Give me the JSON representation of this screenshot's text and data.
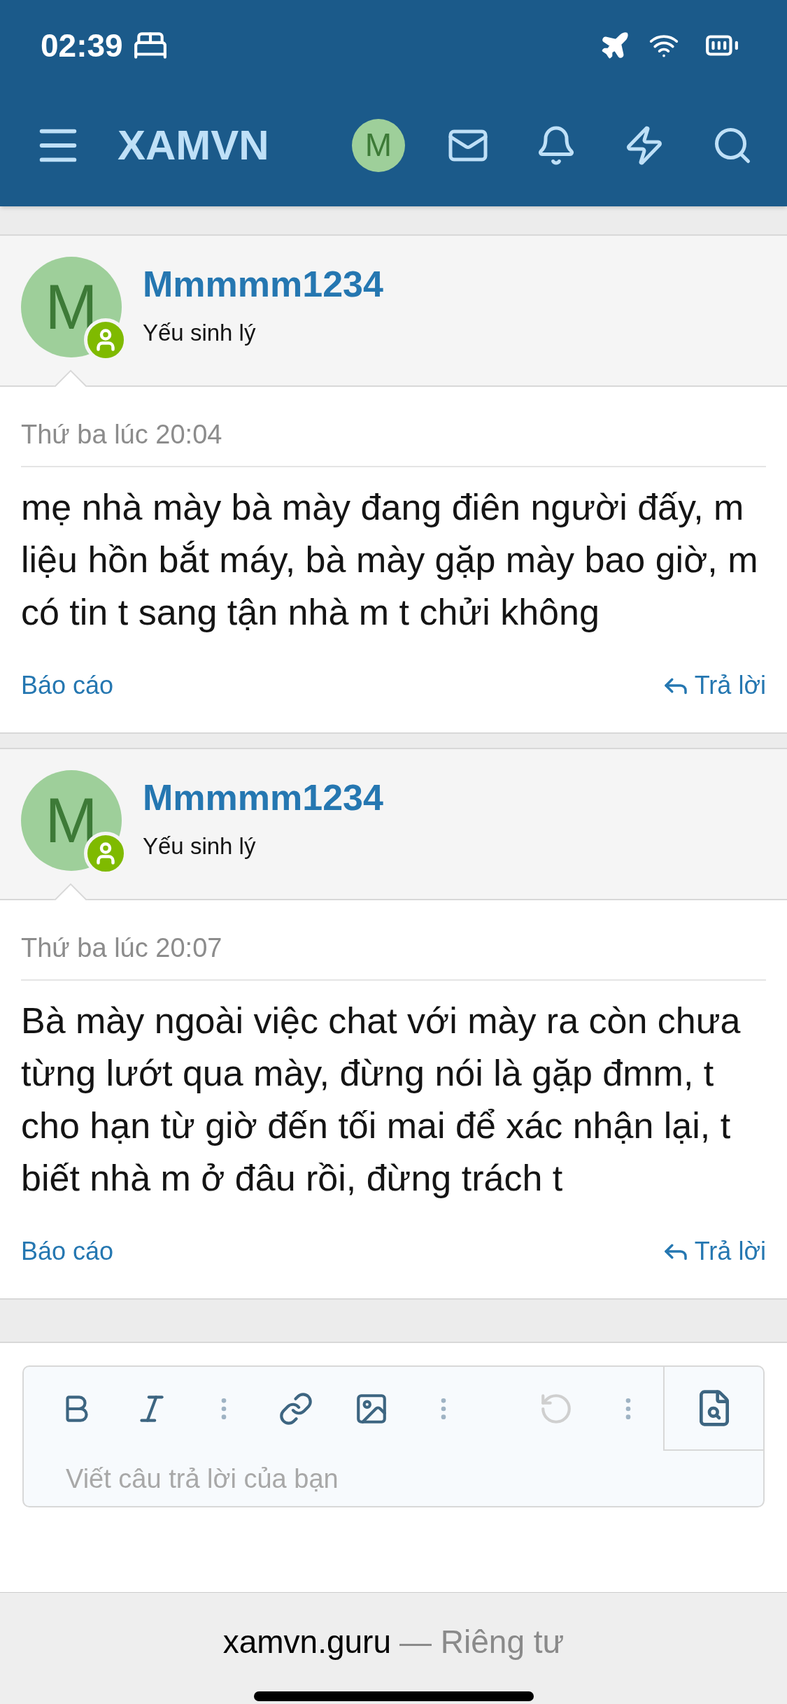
{
  "status_bar": {
    "time": "02:39"
  },
  "header": {
    "logo": "XAMVN",
    "avatar_letter": "M"
  },
  "posts": [
    {
      "username": "Mmmmm1234",
      "user_title": "Yếu sinh lý",
      "avatar_letter": "M",
      "time": "Thứ ba lúc 20:04",
      "body": "mẹ nhà mày bà mày đang điên người đấy, m liệu hồn bắt máy, bà mày gặp mày bao giờ, m có tin t sang tận nhà m t chửi không",
      "report": "Báo cáo",
      "reply": "Trả lời"
    },
    {
      "username": "Mmmmm1234",
      "user_title": "Yếu sinh lý",
      "avatar_letter": "M",
      "time": "Thứ ba lúc 20:07",
      "body": "Bà mày ngoài việc chat với mày ra còn chưa từng lướt qua mày, đừng nói là gặp đmm, t cho hạn từ giờ đến tối mai để xác nhận lại, t biết nhà m ở đâu rồi, đừng trách t",
      "report": "Báo cáo",
      "reply": "Trả lời"
    }
  ],
  "editor": {
    "placeholder": "Viết câu trả lời của bạn"
  },
  "browser_bar": {
    "domain": "xamvn.guru",
    "suffix": "— Riêng tư"
  }
}
